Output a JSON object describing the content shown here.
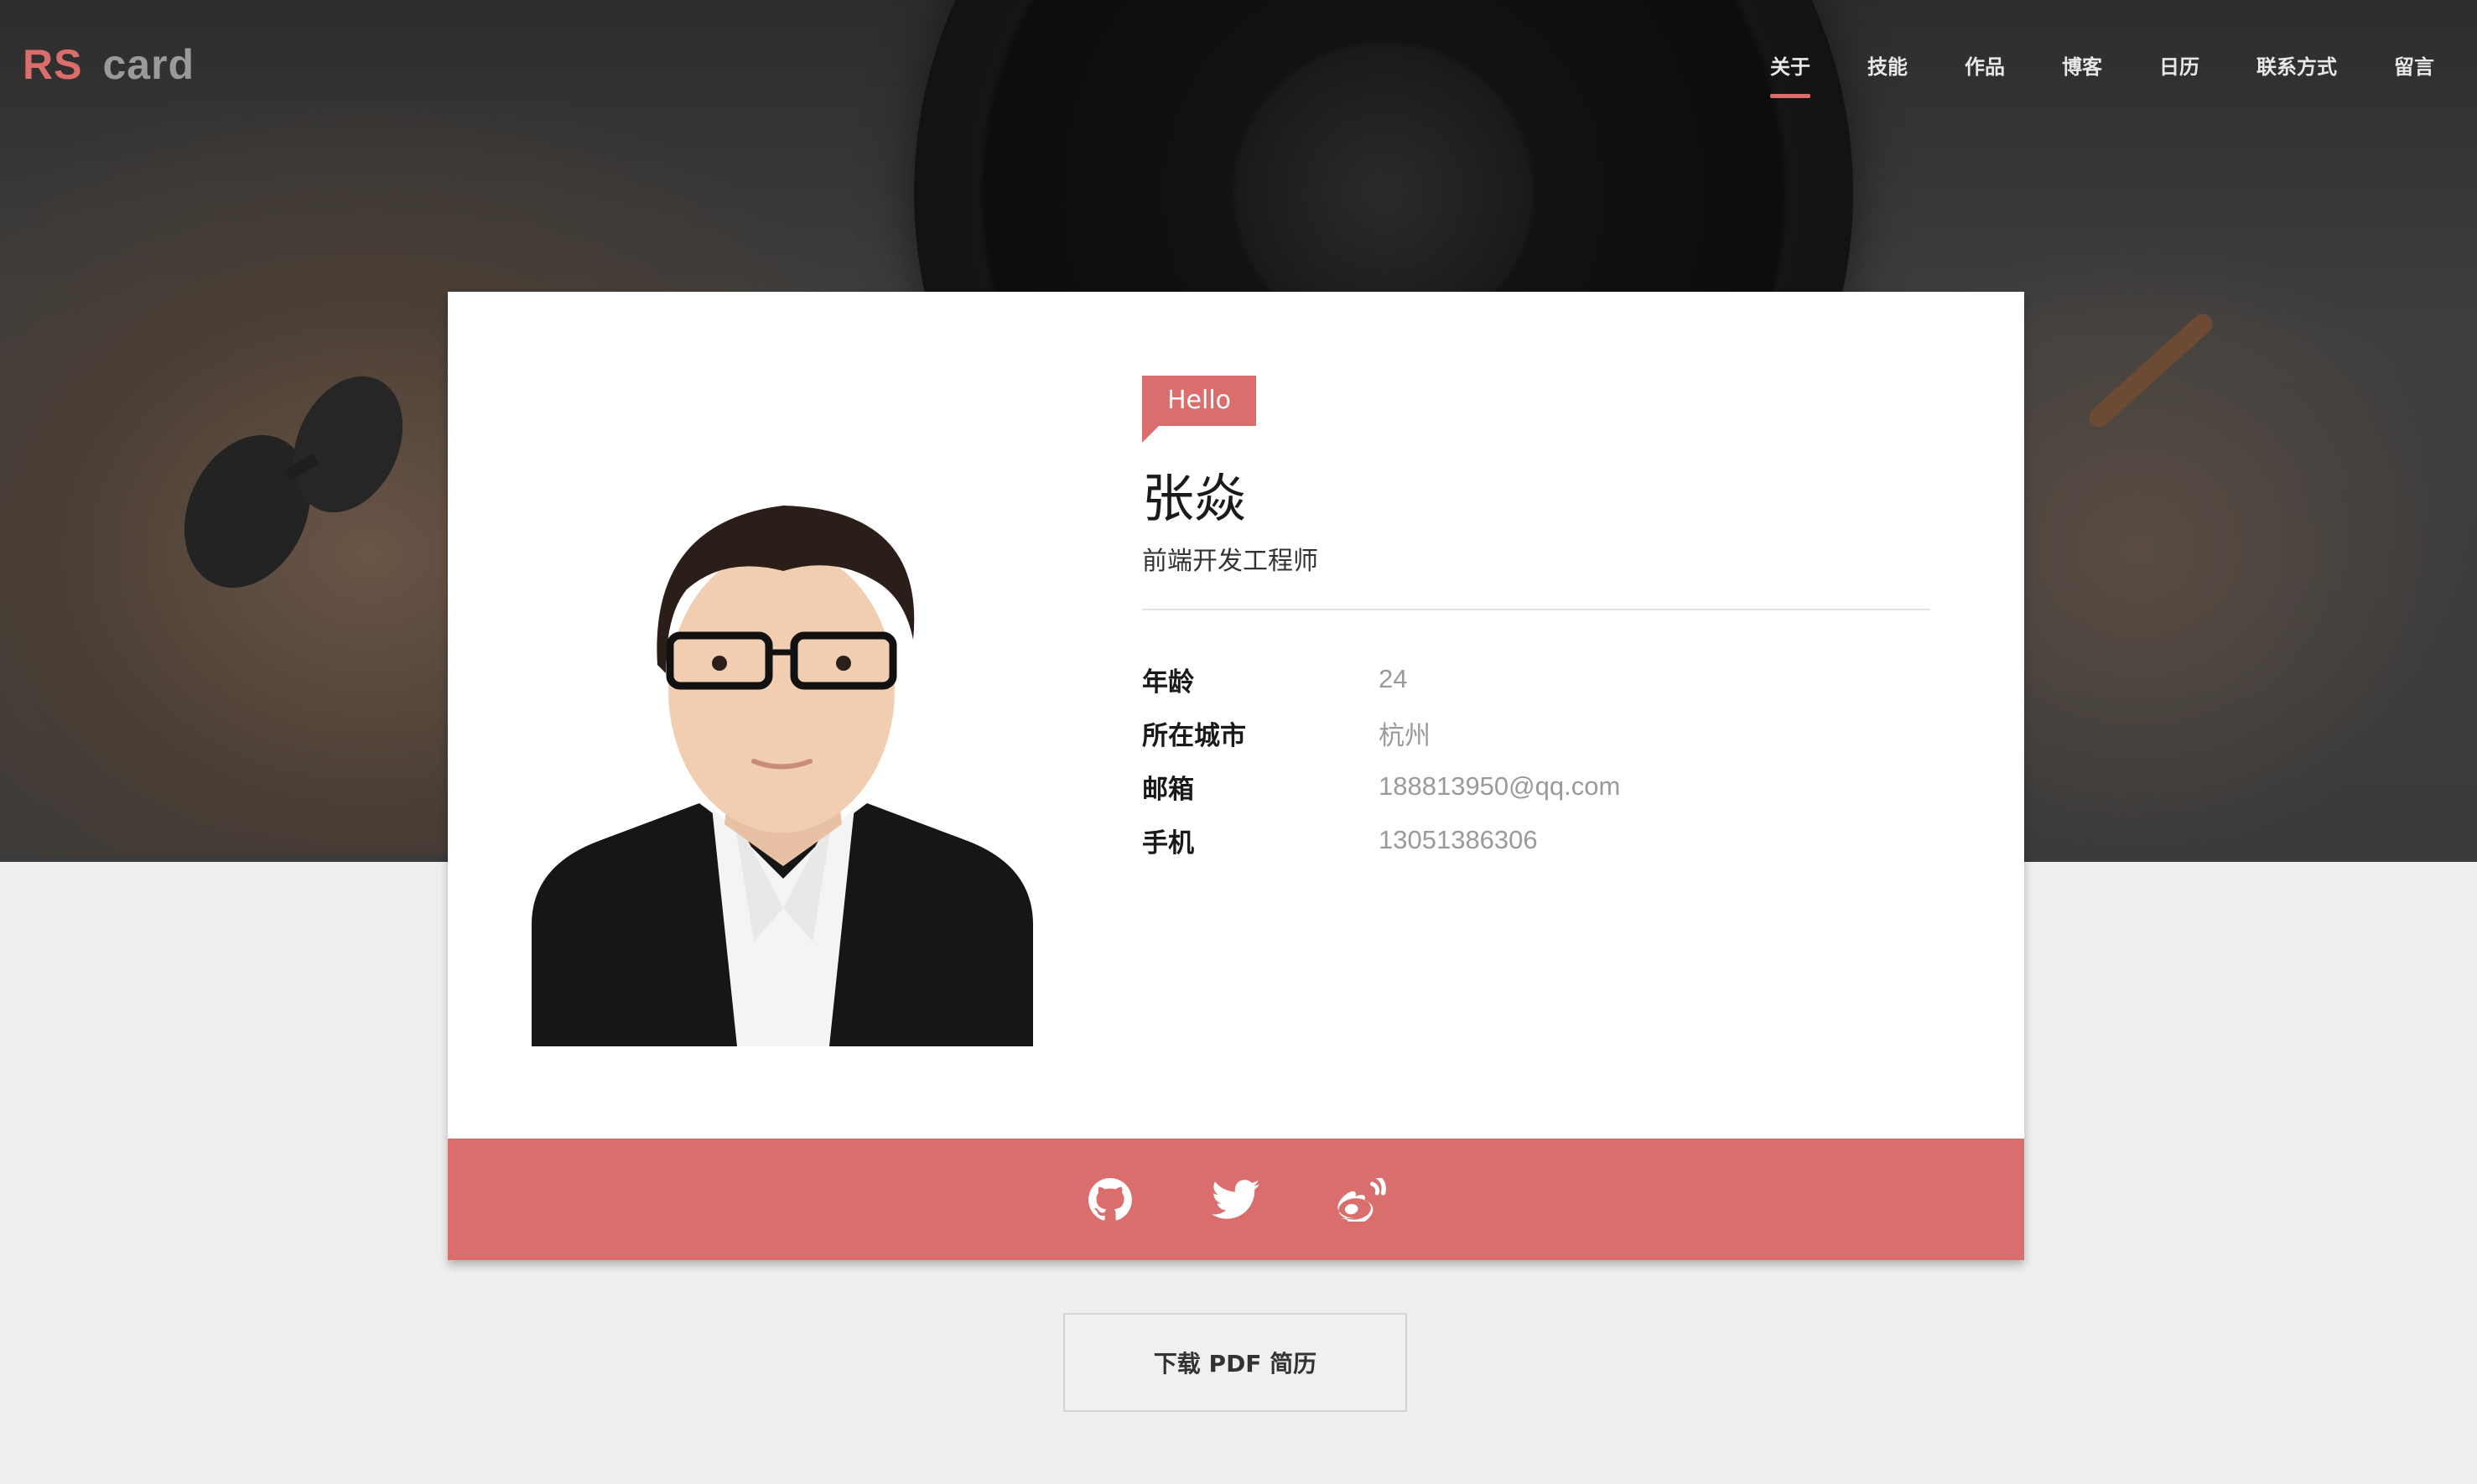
{
  "brand": {
    "part1": "RS",
    "part2": "card",
    "accent": "#d96e6d"
  },
  "nav": {
    "items": [
      {
        "label": "关于",
        "active": true
      },
      {
        "label": "技能"
      },
      {
        "label": "作品"
      },
      {
        "label": "博客"
      },
      {
        "label": "日历"
      },
      {
        "label": "联系方式"
      },
      {
        "label": "留言"
      }
    ]
  },
  "profile": {
    "greeting": "Hello",
    "name": "张焱",
    "title": "前端开发工程师",
    "details": [
      {
        "label": "年龄",
        "value": "24"
      },
      {
        "label": "所在城市",
        "value": "杭州"
      },
      {
        "label": "邮箱",
        "value": "188813950@qq.com"
      },
      {
        "label": "手机",
        "value": "13051386306"
      }
    ]
  },
  "social": {
    "icons": [
      "github-icon",
      "twitter-icon",
      "weibo-icon"
    ]
  },
  "download": {
    "label": "下载 PDF 简历"
  }
}
